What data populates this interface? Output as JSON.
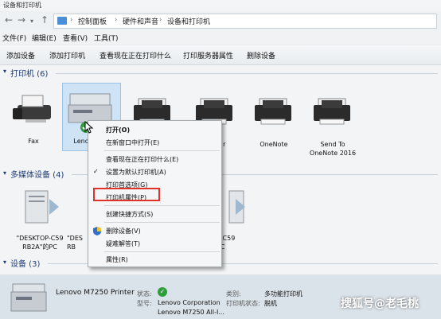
{
  "window": {
    "title": "设备和打印机"
  },
  "address": {
    "path": [
      "控制面板",
      "硬件和声音",
      "设备和打印机"
    ]
  },
  "menubar": [
    "文件(F)",
    "编辑(E)",
    "查看(V)",
    "工具(T)"
  ],
  "commands": [
    "添加设备",
    "添加打印机",
    "查看现在正在打印什么",
    "打印服务器属性",
    "删除设备"
  ],
  "groups": {
    "printers": "打印机 (6)",
    "multimedia": "多媒体设备 (4)",
    "devices": "设备 (3)"
  },
  "printers": [
    {
      "label": "Fax"
    },
    {
      "label": "Leno"
    },
    {
      "label": ""
    },
    {
      "label": "t XPS\nr"
    },
    {
      "label": "OneNote"
    },
    {
      "label": "Send To\nOneNote 2016"
    }
  ],
  "media": [
    {
      "label": "\"DESKTOP-C59\nRB2A\"的PC"
    },
    {
      "label": "\"DES\nRB"
    },
    {
      "label": "P-C59\nPC"
    }
  ],
  "context_menu": {
    "items": [
      {
        "label": "打开(O)",
        "bold": true
      },
      {
        "label": "在新窗口中打开(E)"
      },
      {
        "label": "查看现在正在打印什么(E)"
      },
      {
        "label": "设置为默认打印机(A)",
        "check": true
      },
      {
        "label": "打印首选项(G)"
      },
      {
        "label": "打印机属性(P)",
        "highlight": true
      },
      {
        "label": "创建快捷方式(S)"
      },
      {
        "label": "删除设备(V)",
        "shield": true
      },
      {
        "label": "疑难解答(T)"
      },
      {
        "label": "属性(R)"
      }
    ]
  },
  "details": {
    "name": "Lenovo M7250 Printer",
    "state_label": "状态:",
    "manufacturer": "Lenovo Corporation",
    "model": "Lenovo M7250 All-I...",
    "category_label": "类别:",
    "category": "多功能打印机",
    "printer_state_label": "打印机状态:",
    "printer_state": "脱机",
    "model_label": "型号:",
    "state_ok": "✓"
  },
  "watermark": "搜狐号@老毛桃"
}
